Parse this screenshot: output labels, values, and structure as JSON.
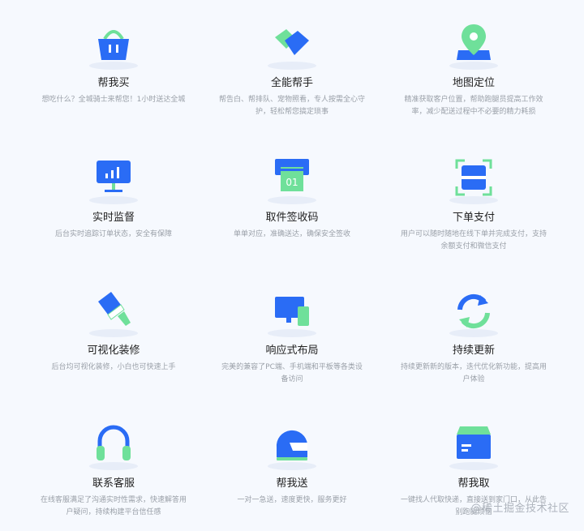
{
  "features": [
    {
      "title": "帮我买",
      "desc": "想吃什么？全城骑士来帮您！1小时送达全城",
      "icon": "shopping-basket-icon"
    },
    {
      "title": "全能帮手",
      "desc": "帮告白、帮排队、宠物照看，专人按需全心守护，轻松帮您搞定琐事",
      "icon": "handshake-icon"
    },
    {
      "title": "地图定位",
      "desc": "精准获取客户位置，帮助跑腿员提高工作效率，减少配送过程中不必要的精力耗损",
      "icon": "map-pin-icon"
    },
    {
      "title": "实时监督",
      "desc": "后台实时追踪订单状态，安全有保障",
      "icon": "monitor-chart-icon"
    },
    {
      "title": "取件签收码",
      "desc": "单单对应，准确送达，确保安全签收",
      "icon": "pickup-code-icon"
    },
    {
      "title": "下单支付",
      "desc": "用户可以随时随地在线下单并完成支付，支持余额支付和微信支付",
      "icon": "scan-icon"
    },
    {
      "title": "可视化装修",
      "desc": "后台均可视化装修，小白也可快速上手",
      "icon": "paint-brush-icon"
    },
    {
      "title": "响应式布局",
      "desc": "完美的兼容了PC端、手机端和平板等各类设备访问",
      "icon": "devices-icon"
    },
    {
      "title": "持续更新",
      "desc": "持续更新新的版本，迭代优化新功能，提高用户体验",
      "icon": "refresh-icon"
    },
    {
      "title": "联系客服",
      "desc": "在线客服满足了沟通实时性需求，快速解答用户疑问，持续构建平台信任感",
      "icon": "headphones-icon"
    },
    {
      "title": "帮我送",
      "desc": "一对一急送，速度更快，服务更好",
      "icon": "helmet-icon"
    },
    {
      "title": "帮我取",
      "desc": "一键找人代取快递，直接送到家门口，从此告别跑腿烦恼",
      "icon": "box-icon"
    }
  ],
  "watermark": "@稀土掘金技术社区",
  "colors": {
    "blue": "#2a6cf5",
    "green": "#6fe09a",
    "accent_text": "#222222",
    "desc_text": "#9aa0a8"
  }
}
